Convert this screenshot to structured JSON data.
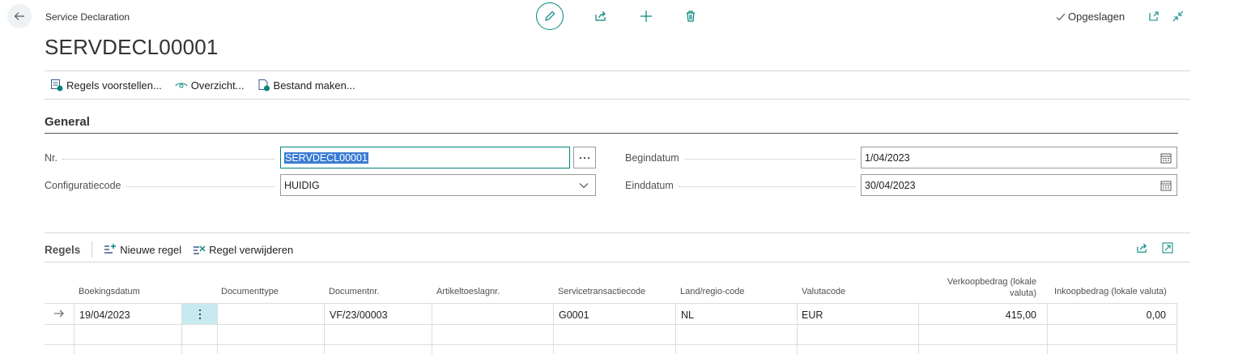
{
  "header": {
    "caption": "Service Declaration",
    "title": "SERVDECL00001",
    "saved_status": "Opgeslagen"
  },
  "actions": [
    {
      "label": "Regels voorstellen..."
    },
    {
      "label": "Overzicht..."
    },
    {
      "label": "Bestand maken..."
    }
  ],
  "general": {
    "section_title": "General",
    "fields": {
      "nr": {
        "label": "Nr.",
        "value": "SERVDECL00001"
      },
      "configuratiecode": {
        "label": "Configuratiecode",
        "value": "HUIDIG"
      },
      "begindatum": {
        "label": "Begindatum",
        "value": "1/04/2023"
      },
      "einddatum": {
        "label": "Einddatum",
        "value": "30/04/2023"
      }
    }
  },
  "lines": {
    "title": "Regels",
    "new_line": "Nieuwe regel",
    "delete_line": "Regel verwijderen",
    "columns": [
      {
        "label": "Boekingsdatum"
      },
      {
        "label": "Documenttype"
      },
      {
        "label": "Documentnr."
      },
      {
        "label": "Artikeltoeslagnr."
      },
      {
        "label": "Servicetransactiecode"
      },
      {
        "label": "Land/regio-code"
      },
      {
        "label": "Valutacode"
      },
      {
        "label": "Verkoopbedrag (lokale valuta)"
      },
      {
        "label": "Inkoopbedrag (lokale valuta)"
      }
    ],
    "rows": [
      {
        "boekingsdatum": "19/04/2023",
        "documenttype": "",
        "documentnr": "VF/23/00003",
        "artikeltoeslagnr": "",
        "servicetransactiecode": "G0001",
        "landregio": "NL",
        "valutacode": "EUR",
        "verkoopbedrag": "415,00",
        "inkoopbedrag": "0,00"
      }
    ]
  },
  "colors": {
    "accent": "#00857c",
    "selection": "#3b7bd4",
    "row_menu_bg": "#c7eaf0"
  }
}
